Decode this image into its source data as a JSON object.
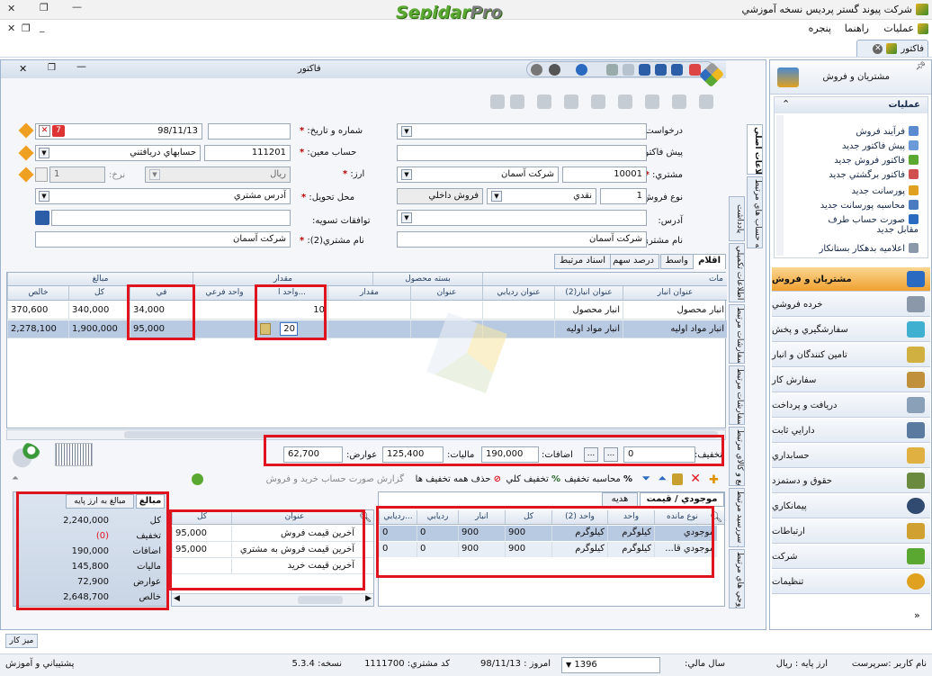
{
  "app": {
    "title": "شرکت پیوند گستر پردیس نسخه آموزشي",
    "logo_part1": "Sepidar",
    "logo_part2": "Pro"
  },
  "menu": {
    "items": [
      "عمليات",
      "راهنما",
      "پنجره"
    ]
  },
  "doc_tab": {
    "label": "فاکتور"
  },
  "window": {
    "title": "فاکتور"
  },
  "form": {
    "sales_request": {
      "label": "درخواست فروش:",
      "value": ""
    },
    "proforma": {
      "label": "پيش فاکتور:",
      "value": ""
    },
    "customer": {
      "label": "مشتري:",
      "code": "10001",
      "name": "شرکت آسمان"
    },
    "sale_type": {
      "label": "نوع فروش:",
      "code": "1",
      "payment": "نقدي",
      "kind": "فروش داخلي"
    },
    "address": {
      "label": "آدرس:",
      "value": ""
    },
    "customer_name": {
      "label": "نام مشتري:",
      "value": "شرکت آسمان"
    },
    "number_date": {
      "label": "شماره و تاريخ:",
      "number": "",
      "date": "98/11/13"
    },
    "account": {
      "label": "حساب معين:",
      "code": "111201",
      "name": "حسابهاي دريافتني"
    },
    "currency": {
      "label": "ارز:",
      "value": "ريال",
      "rate_label": "نرخ:",
      "rate": "1"
    },
    "delivery": {
      "label": "محل تحويل:",
      "value": "آدرس مشتري"
    },
    "settlement": {
      "label": "توافقات تسويه:",
      "value": ""
    },
    "customer2": {
      "label": "نام مشتري(2):",
      "value": "شرکت آسمان"
    }
  },
  "side_tabs": [
    "اطلاعات اصلي",
    "تسويه حساب هاي مرتبط",
    "يادداشت",
    "اطلاعات تکميلي",
    "سفارشات مرتبط",
    "ثبت سفارشات مرتبط",
    "توزيع و کالاي مرتبط",
    "سند سررسيد مرتبط",
    "حواله خروجي هاي مرتبط"
  ],
  "grid_tabs": [
    "اقلام",
    "واسط",
    "درصد سهم",
    "اسناد مرتبط"
  ],
  "grid": {
    "group_headers": {
      "packaging": "بسته محصول",
      "quantity": "مقدار",
      "amounts": "مبالغ",
      "extra": "مات"
    },
    "columns": [
      "عنوان انبار",
      "عنوان انبار(2)",
      "عنوان رديابي",
      "عنوان",
      "مقدار",
      "واحد ا...",
      "واحد فرعي",
      "في",
      "کل",
      "خالص"
    ],
    "rows": [
      {
        "warehouse": "انبار محصول",
        "warehouse2": "انبار محصول",
        "qty": "10",
        "fee": "34,000",
        "total": "340,000",
        "net": "370,600"
      },
      {
        "warehouse": "انبار مواد اوليه",
        "warehouse2": "انبار مواد اوليه",
        "qty": "20",
        "fee": "95,000",
        "total": "1,900,000",
        "net": "2,278,100"
      }
    ]
  },
  "totals": {
    "discount_label": "تخفيف:",
    "discount": "0",
    "addition_label": "اضافات:",
    "addition": "190,000",
    "tax_label": "ماليات:",
    "tax": "125,400",
    "duties_label": "عوارض:",
    "duties": "62,700"
  },
  "actions": {
    "calc_discount": "محاسبه تخفيف",
    "total_discount": "تخفيف کلي",
    "remove_discounts": "حذف همه تخفيف ها",
    "report": "گزارش صورت حساب خريد و فروش"
  },
  "bottom_tabs": {
    "stock_price": "موجودي / قيمت",
    "gift": "هديه"
  },
  "stock_table": {
    "columns": [
      "نوع مانده",
      "واحد",
      "واحد (2)",
      "کل",
      "انبار",
      "رديابي",
      "رديابي..."
    ],
    "rows": [
      {
        "type": "موجودي",
        "unit": "کيلوگرم",
        "unit2": "کيلوگرم",
        "total": "900",
        "store": "900",
        "track": "0",
        "track2": "0"
      },
      {
        "type": "موجودي قا...",
        "unit": "کيلوگرم",
        "unit2": "کيلوگرم",
        "total": "900",
        "store": "900",
        "track": "0",
        "track2": "0"
      }
    ]
  },
  "price_table": {
    "columns": [
      "عنوان",
      "کل"
    ],
    "rows": [
      {
        "title": "آخرين قيمت فروش",
        "value": "95,000"
      },
      {
        "title": "آخرين قيمت فروش به مشتري",
        "value": "95,000"
      },
      {
        "title": "آخرين قيمت خريد",
        "value": ""
      }
    ]
  },
  "summary": {
    "tabs": [
      "مبالغ",
      "مبالغ به ارز پايه"
    ],
    "rows": [
      {
        "label": "کل",
        "value": "2,240,000"
      },
      {
        "label": "تخفيف",
        "value": "(0)"
      },
      {
        "label": "اضافات",
        "value": "190,000"
      },
      {
        "label": "ماليات",
        "value": "145,800"
      },
      {
        "label": "عوارض",
        "value": "72,900"
      },
      {
        "label": "خالص",
        "value": "2,648,700"
      }
    ]
  },
  "right_panel": {
    "header": "مشتريان و فروش",
    "operations_title": "عمليات",
    "operations": [
      "فرآيند فروش",
      "پيش فاکتور جديد",
      "فاکتور فروش جديد",
      "فاکتور برگشتي جديد",
      "پورسانت جديد",
      "محاسبه پورسانت جديد",
      "صورت حساب طرف مقابل جديد",
      "اعلاميه بدهکار بستانکار"
    ],
    "nav": [
      "مشتريان و فروش",
      "خرده فروشي",
      "سفارشگيري و پخش",
      "تامين کنندگان و انبار",
      "سفارش کار",
      "دريافت و پرداخت",
      "دارايي ثابت",
      "حسابداري",
      "حقوق و دستمزد",
      "پيمانکاري",
      "ارتباطات",
      "شرکت",
      "تنظيمات"
    ]
  },
  "taskbar": {
    "label": "ميز کار"
  },
  "status": {
    "user": "نام کاربر :سرپرست",
    "base_currency": "ارز پايه : ريال",
    "fiscal_year_label": "سال مالي:",
    "fiscal_year": "1396",
    "today": "امروز : 98/11/13",
    "customer_code": "کد مشتري: 1111700",
    "version": "نسخه: 5.3.4",
    "support": "پشتيباني و آموزش"
  },
  "colors": {
    "accent": "#5aa832",
    "highlight_red": "#e0141e",
    "selected_row": "#b8c9e2",
    "nav_active": "#f0a030"
  }
}
